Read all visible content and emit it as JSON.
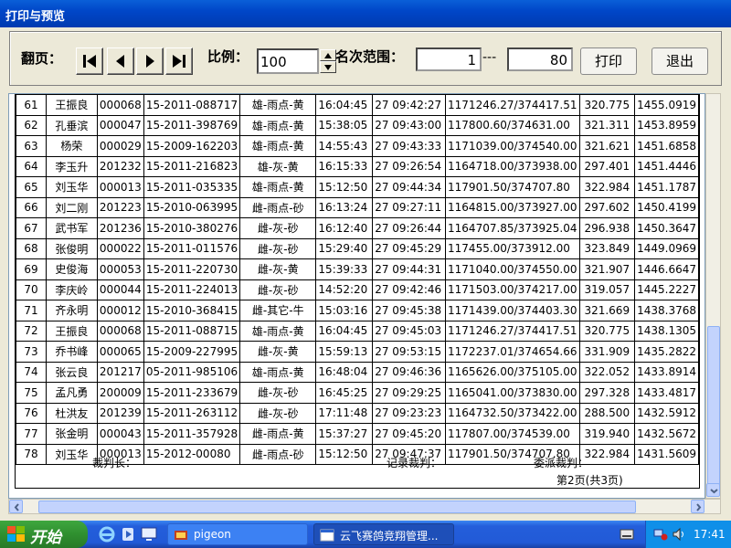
{
  "window": {
    "title": "打印与预览"
  },
  "toolbar": {
    "page_label": "翻页：",
    "scale_label": "比例：",
    "scale_value": "100",
    "range_label": "名次范围：",
    "range_from": "1",
    "range_sep": "---",
    "range_to": "80",
    "print_label": "打印",
    "exit_label": "退出"
  },
  "table": {
    "rows": [
      [
        "61",
        "王振良",
        "000068",
        "15-2011-088717",
        "雄-雨点-黄",
        "16:04:45",
        "27 09:42:27",
        "1171246.27/374417.51",
        "320.775",
        "1455.0919"
      ],
      [
        "62",
        "孔垂滨",
        "000047",
        "15-2011-398769",
        "雄-雨点-黄",
        "15:38:05",
        "27 09:43:00",
        "117800.60/374631.00",
        "321.311",
        "1453.8959"
      ],
      [
        "63",
        "杨荣",
        "000029",
        "15-2009-162203",
        "雄-雨点-黄",
        "14:55:43",
        "27 09:43:33",
        "1171039.00/374540.00",
        "321.621",
        "1451.6858"
      ],
      [
        "64",
        "李玉升",
        "201232",
        "15-2011-216823",
        "雄-灰-黄",
        "16:15:33",
        "27 09:26:54",
        "1164718.00/373938.00",
        "297.401",
        "1451.4446"
      ],
      [
        "65",
        "刘玉华",
        "000013",
        "15-2011-035335",
        "雄-雨点-黄",
        "15:12:50",
        "27 09:44:34",
        "117901.50/374707.80",
        "322.984",
        "1451.1787"
      ],
      [
        "66",
        "刘二刚",
        "201223",
        "15-2010-063995",
        "雌-雨点-砂",
        "16:13:24",
        "27 09:27:11",
        "1164815.00/373927.00",
        "297.602",
        "1450.4199"
      ],
      [
        "67",
        "武书军",
        "201236",
        "15-2010-380276",
        "雌-灰-砂",
        "16:12:40",
        "27 09:26:44",
        "1164707.85/373925.04",
        "296.938",
        "1450.3647"
      ],
      [
        "68",
        "张俊明",
        "000022",
        "15-2011-011576",
        "雌-灰-砂",
        "15:29:40",
        "27 09:45:29",
        "117455.00/373912.00",
        "323.849",
        "1449.0969"
      ],
      [
        "69",
        "史俊海",
        "000053",
        "15-2011-220730",
        "雌-灰-黄",
        "15:39:33",
        "27 09:44:31",
        "1171040.00/374550.00",
        "321.907",
        "1446.6647"
      ],
      [
        "70",
        "李庆岭",
        "000044",
        "15-2011-224013",
        "雌-灰-砂",
        "14:52:20",
        "27 09:42:46",
        "1171503.00/374217.00",
        "319.057",
        "1445.2227"
      ],
      [
        "71",
        "齐永明",
        "000012",
        "15-2010-368415",
        "雌-其它-牛",
        "15:03:16",
        "27 09:45:38",
        "1171439.00/374403.30",
        "321.669",
        "1438.3768"
      ],
      [
        "72",
        "王振良",
        "000068",
        "15-2011-088715",
        "雄-雨点-黄",
        "16:04:45",
        "27 09:45:03",
        "1171246.27/374417.51",
        "320.775",
        "1438.1305"
      ],
      [
        "73",
        "乔书峰",
        "000065",
        "15-2009-227995",
        "雌-灰-黄",
        "15:59:13",
        "27 09:53:15",
        "1172237.01/374654.66",
        "331.909",
        "1435.2822"
      ],
      [
        "74",
        "张云良",
        "201217",
        "05-2011-985106",
        "雄-雨点-黄",
        "16:48:04",
        "27 09:46:36",
        "1165626.00/375105.00",
        "322.052",
        "1433.8914"
      ],
      [
        "75",
        "孟凡勇",
        "200009",
        "15-2011-233679",
        "雌-灰-砂",
        "16:45:25",
        "27 09:29:25",
        "1165041.00/373830.00",
        "297.328",
        "1433.4817"
      ],
      [
        "76",
        "杜洪友",
        "201239",
        "15-2011-263112",
        "雌-灰-砂",
        "17:11:48",
        "27 09:23:23",
        "1164732.50/373422.00",
        "288.500",
        "1432.5912"
      ],
      [
        "77",
        "张金明",
        "000043",
        "15-2011-357928",
        "雌-雨点-黄",
        "15:37:27",
        "27 09:45:20",
        "117807.00/374539.00",
        "319.940",
        "1432.5672"
      ],
      [
        "78",
        "刘玉华",
        "000013",
        "15-2012-00080",
        "雌-雨点-砂",
        "15:12:50",
        "27 09:47:37",
        "117901.50/374707.80",
        "322.984",
        "1431.5609"
      ]
    ]
  },
  "footer": {
    "chief_referee": "裁判长：",
    "record_referee": "记录裁判：",
    "appointed_referee": "委派裁判：",
    "page_info": "第2页(共3页)"
  },
  "taskbar": {
    "start_label": "开始",
    "task1_label": "pigeon",
    "task2_label": "云飞赛鸽竞翔管理...",
    "clock": "17:41"
  }
}
